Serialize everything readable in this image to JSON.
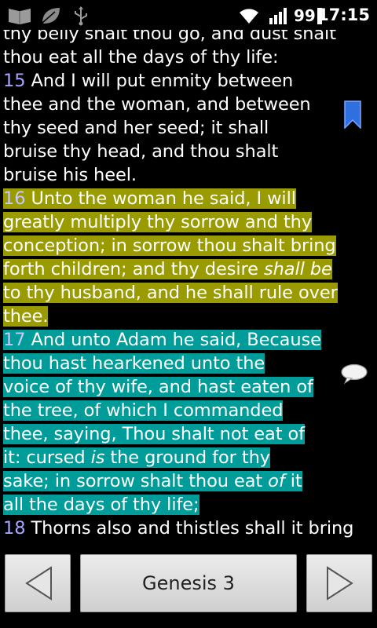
{
  "status_bar": {
    "battery_percent": "99",
    "time": "17:15",
    "icons": [
      "bible-app-icon",
      "notification-leaf-icon",
      "usb-icon",
      "wifi-icon",
      "signal-icon",
      "battery-icon"
    ]
  },
  "reader": {
    "top_partial_line": "thy belly shalt thou go, and dust shalt",
    "lines": [
      {
        "segments": [
          {
            "text": "thou eat all the days of thy life:"
          }
        ]
      },
      {
        "segments": [
          {
            "num": "15",
            "text": " And I will put enmity between"
          }
        ]
      },
      {
        "segments": [
          {
            "text": "thee and the woman, and between"
          }
        ]
      },
      {
        "segments": [
          {
            "text": "thy seed and her seed; it shall"
          }
        ]
      },
      {
        "segments": [
          {
            "text": "bruise thy head, and thou shalt"
          }
        ]
      },
      {
        "segments": [
          {
            "text": "bruise his heel."
          }
        ]
      }
    ],
    "verse16": {
      "number": "16",
      "highlight": "#9a9b00",
      "lines": [
        " Unto the woman he said, I will",
        "greatly multiply thy sorrow and thy",
        "conception; in sorrow thou shalt bring",
        "forth children; and thy desire |shall be|",
        "to thy husband, and he shall rule over",
        "thee."
      ]
    },
    "verse17": {
      "number": "17",
      "highlight": "#009c9a",
      "lines": [
        " And unto Adam he said, Because",
        "thou hast hearkened unto the",
        "voice of thy wife, and hast eaten of",
        "the tree, of which I commanded",
        "thee, saying, Thou shalt not eat of",
        "it: cursed |is| the ground for thy",
        "sake; in sorrow shalt thou eat |of| it",
        "all the days of thy life;"
      ]
    },
    "verse18": {
      "number": "18",
      "text": " Thorns also and thistles shall it bring"
    },
    "colors": {
      "verse_number": "#a6a6ff",
      "text": "#ffffff",
      "background": "#000000"
    }
  },
  "navigation": {
    "prev_icon": "left-arrow-icon",
    "chapter_label": "Genesis 3",
    "next_icon": "right-arrow-icon"
  }
}
